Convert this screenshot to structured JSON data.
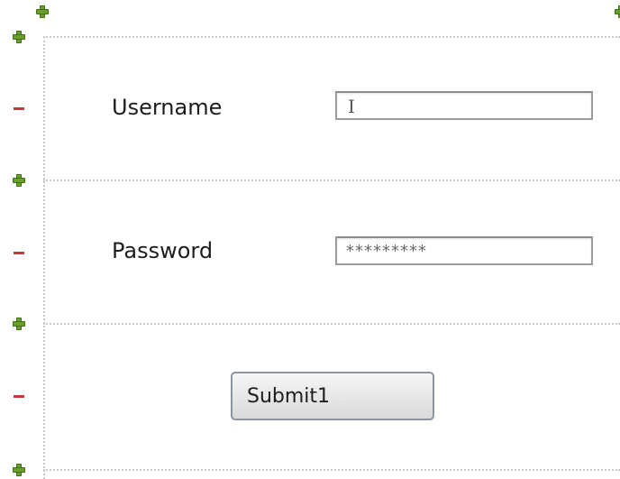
{
  "form": {
    "username_label": "Username",
    "username_value": "",
    "password_label": "Password",
    "password_value": "*********",
    "submit_label": "Submit1"
  },
  "icons": {
    "row_add": "plus-icon",
    "row_remove": "minus-icon",
    "text_cursor": "i-beam-cursor-icon"
  },
  "colors": {
    "add_handle": "#6a9f2a",
    "remove_handle": "#c23a3a",
    "guide": "#c8c8c8"
  }
}
